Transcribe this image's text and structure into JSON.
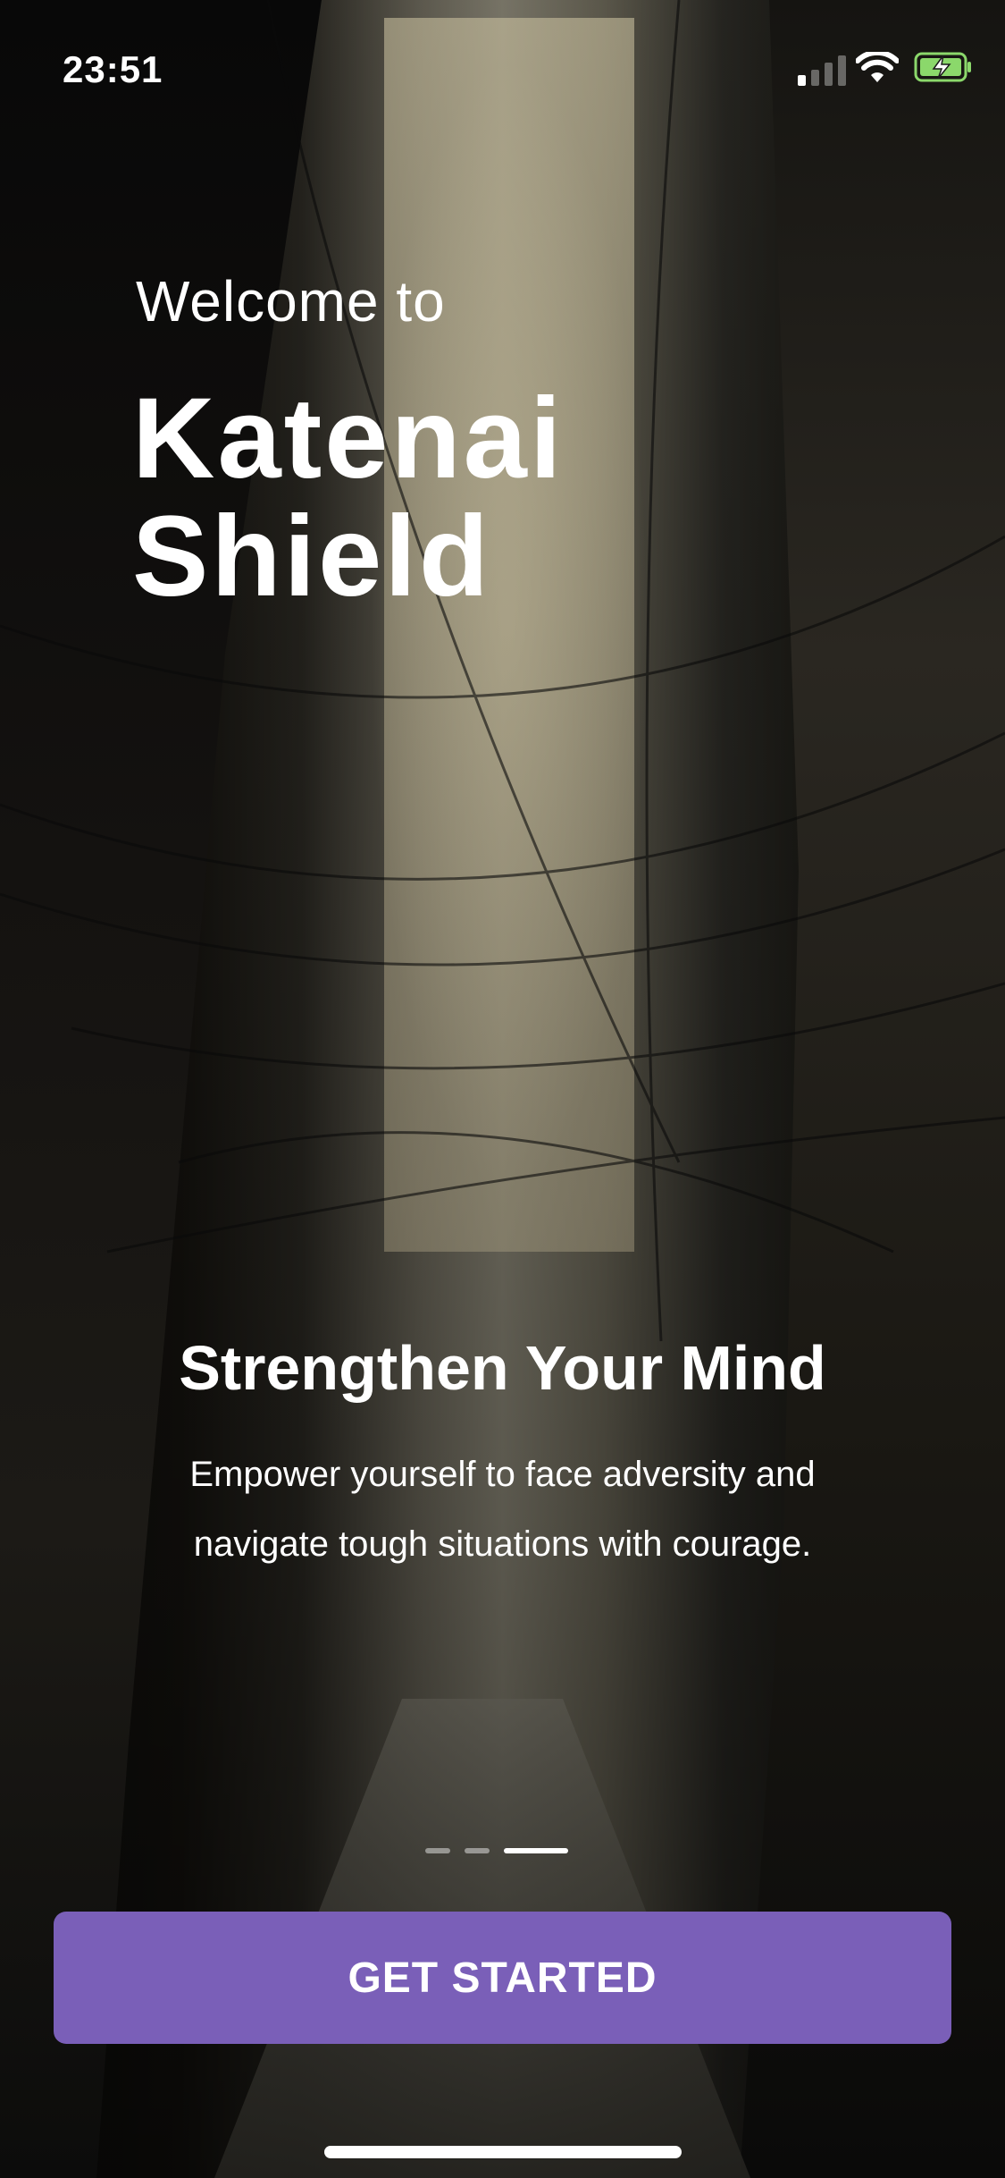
{
  "status_bar": {
    "time": "23:51",
    "signal_icon": "cellular-signal-icon",
    "wifi_icon": "wifi-icon",
    "battery_icon": "battery-charging-icon",
    "battery_color": "#8bd86b"
  },
  "hero": {
    "welcome": "Welcome to",
    "app_name": "Katenai Shield"
  },
  "slide": {
    "title": "Strengthen Your Mind",
    "description": "Empower yourself to face adversity and navigate tough situations with courage."
  },
  "pager": {
    "total": 3,
    "active_index": 2
  },
  "cta": {
    "label": "GET STARTED",
    "color": "#7a5fb8"
  }
}
